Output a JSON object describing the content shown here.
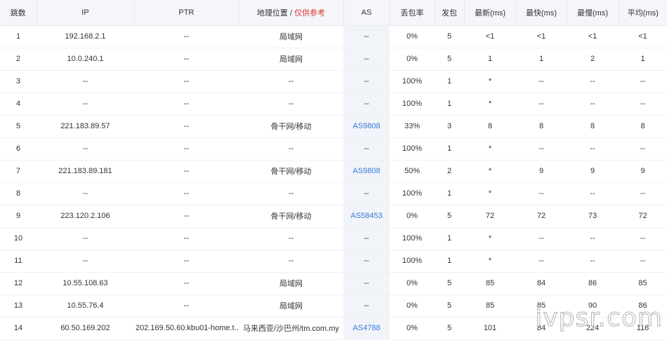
{
  "table": {
    "headers": {
      "hop": "跳数",
      "ip": "IP",
      "ptr": "PTR",
      "geo": "地理位置",
      "geo_sep": " / ",
      "geo_ref": "仅供参考",
      "as": "AS",
      "loss": "丢包率",
      "sent": "发包",
      "last": "最新(ms)",
      "best": "最快(ms)",
      "worst": "最慢(ms)",
      "avg": "平均(ms)"
    },
    "rows": [
      {
        "hop": "1",
        "ip": "192.168.2.1",
        "ptr": "--",
        "geo": "局域网",
        "as": "--",
        "loss": "0%",
        "sent": "5",
        "last": "<1",
        "best": "<1",
        "worst": "<1",
        "avg": "<1"
      },
      {
        "hop": "2",
        "ip": "10.0.240.1",
        "ptr": "--",
        "geo": "局域网",
        "as": "--",
        "loss": "0%",
        "sent": "5",
        "last": "1",
        "best": "1",
        "worst": "2",
        "avg": "1"
      },
      {
        "hop": "3",
        "ip": "--",
        "ptr": "--",
        "geo": "--",
        "as": "--",
        "loss": "100%",
        "sent": "1",
        "last": "*",
        "best": "--",
        "worst": "--",
        "avg": "--"
      },
      {
        "hop": "4",
        "ip": "--",
        "ptr": "--",
        "geo": "--",
        "as": "--",
        "loss": "100%",
        "sent": "1",
        "last": "*",
        "best": "--",
        "worst": "--",
        "avg": "--"
      },
      {
        "hop": "5",
        "ip": "221.183.89.57",
        "ptr": "--",
        "geo": "骨干网/移动",
        "as": "AS9808",
        "loss": "33%",
        "sent": "3",
        "last": "8",
        "best": "8",
        "worst": "8",
        "avg": "8"
      },
      {
        "hop": "6",
        "ip": "--",
        "ptr": "--",
        "geo": "--",
        "as": "--",
        "loss": "100%",
        "sent": "1",
        "last": "*",
        "best": "--",
        "worst": "--",
        "avg": "--"
      },
      {
        "hop": "7",
        "ip": "221.183.89.181",
        "ptr": "--",
        "geo": "骨干网/移动",
        "as": "AS9808",
        "loss": "50%",
        "sent": "2",
        "last": "*",
        "best": "9",
        "worst": "9",
        "avg": "9"
      },
      {
        "hop": "8",
        "ip": "--",
        "ptr": "--",
        "geo": "--",
        "as": "--",
        "loss": "100%",
        "sent": "1",
        "last": "*",
        "best": "--",
        "worst": "--",
        "avg": "--"
      },
      {
        "hop": "9",
        "ip": "223.120.2.106",
        "ptr": "--",
        "geo": "骨干网/移动",
        "as": "AS58453",
        "loss": "0%",
        "sent": "5",
        "last": "72",
        "best": "72",
        "worst": "73",
        "avg": "72"
      },
      {
        "hop": "10",
        "ip": "--",
        "ptr": "--",
        "geo": "--",
        "as": "--",
        "loss": "100%",
        "sent": "1",
        "last": "*",
        "best": "--",
        "worst": "--",
        "avg": "--"
      },
      {
        "hop": "11",
        "ip": "--",
        "ptr": "--",
        "geo": "--",
        "as": "--",
        "loss": "100%",
        "sent": "1",
        "last": "*",
        "best": "--",
        "worst": "--",
        "avg": "--"
      },
      {
        "hop": "12",
        "ip": "10.55.108.63",
        "ptr": "--",
        "geo": "局域网",
        "as": "--",
        "loss": "0%",
        "sent": "5",
        "last": "85",
        "best": "84",
        "worst": "86",
        "avg": "85"
      },
      {
        "hop": "13",
        "ip": "10.55.76.4",
        "ptr": "--",
        "geo": "局域网",
        "as": "--",
        "loss": "0%",
        "sent": "5",
        "last": "85",
        "best": "85",
        "worst": "90",
        "avg": "86"
      },
      {
        "hop": "14",
        "ip": "60.50.169.202",
        "ptr": "202.169.50.60.kbu01-home.t...",
        "geo": "马来西亚/沙巴州/tm.com.my",
        "as": "AS4788",
        "loss": "0%",
        "sent": "5",
        "last": "101",
        "best": "84",
        "worst": "224",
        "avg": "116"
      }
    ]
  },
  "watermark": "ivpsr.com",
  "colors": {
    "link": "#3a78d6",
    "geo_ref": "#e0342f",
    "header_bg": "#f4f6f9",
    "as_col_bg": "#f1f4f9"
  }
}
